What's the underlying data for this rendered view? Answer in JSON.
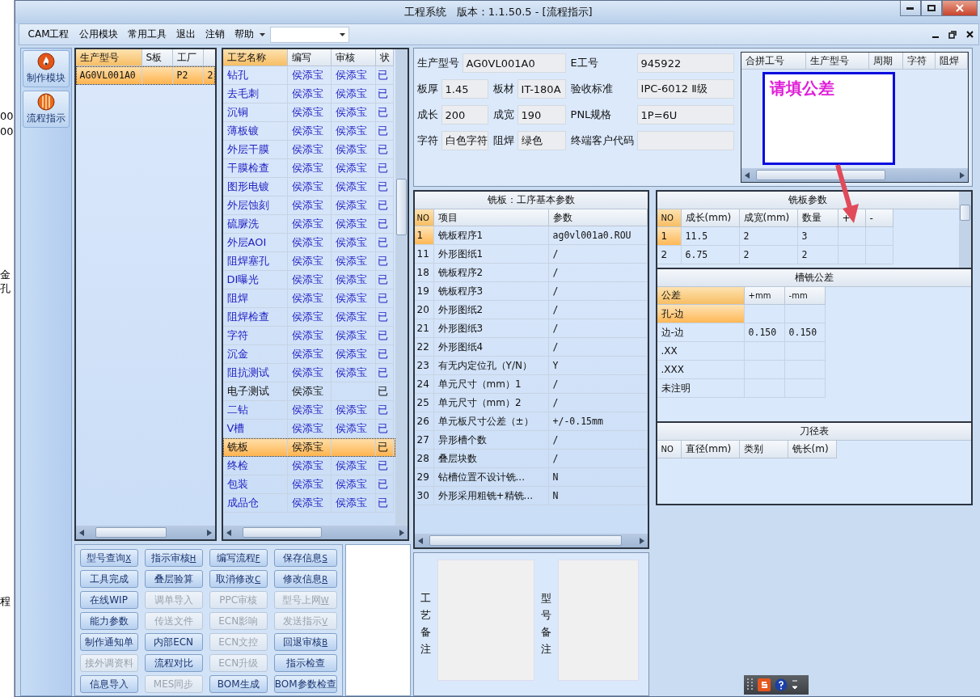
{
  "window": {
    "title": "工程系统   版本：1.1.50.5 - [流程指示]"
  },
  "background_window": {
    "texts": [
      "00",
      "00",
      "金",
      "孔",
      "程"
    ]
  },
  "menu": {
    "items": [
      "CAM工程",
      "公用模块",
      "常用工具",
      "退出",
      "注销",
      "帮助"
    ]
  },
  "nav": [
    {
      "label": "制作模块",
      "kind": "flame"
    },
    {
      "label": "流程指示",
      "kind": "stripes"
    }
  ],
  "models": {
    "columns": [
      "生产型号",
      "S板",
      "工厂"
    ],
    "rows": [
      {
        "model": "AG0VL001A0",
        "factory": "P2",
        "column_4": "2",
        "selected": true
      }
    ]
  },
  "processes": {
    "columns": [
      "工艺名称",
      "编写",
      "审核",
      "状"
    ],
    "rows": [
      {
        "name": "钻孔",
        "writer": "侯添宝",
        "reviewer": "侯添宝",
        "status": "已",
        "reviewed": true,
        "selected": false
      },
      {
        "name": "去毛刺",
        "writer": "侯添宝",
        "reviewer": "侯添宝",
        "status": "已",
        "reviewed": true,
        "selected": false
      },
      {
        "name": "沉铜",
        "writer": "侯添宝",
        "reviewer": "侯添宝",
        "status": "已",
        "reviewed": true,
        "selected": false
      },
      {
        "name": "薄板镀",
        "writer": "侯添宝",
        "reviewer": "侯添宝",
        "status": "已",
        "reviewed": true,
        "selected": false
      },
      {
        "name": "外层干膜",
        "writer": "侯添宝",
        "reviewer": "侯添宝",
        "status": "已",
        "reviewed": true,
        "selected": false
      },
      {
        "name": "干膜检查",
        "writer": "侯添宝",
        "reviewer": "侯添宝",
        "status": "已",
        "reviewed": true,
        "selected": false
      },
      {
        "name": "图形电镀",
        "writer": "侯添宝",
        "reviewer": "侯添宝",
        "status": "已",
        "reviewed": true,
        "selected": false
      },
      {
        "name": "外层蚀刻",
        "writer": "侯添宝",
        "reviewer": "侯添宝",
        "status": "已",
        "reviewed": true,
        "selected": false
      },
      {
        "name": "硫脲洗",
        "writer": "侯添宝",
        "reviewer": "侯添宝",
        "status": "已",
        "reviewed": true,
        "selected": false
      },
      {
        "name": "外层AOI",
        "writer": "侯添宝",
        "reviewer": "侯添宝",
        "status": "已",
        "reviewed": true,
        "selected": false
      },
      {
        "name": "阻焊塞孔",
        "writer": "侯添宝",
        "reviewer": "侯添宝",
        "status": "已",
        "reviewed": true,
        "selected": false
      },
      {
        "name": "DI曝光",
        "writer": "侯添宝",
        "reviewer": "侯添宝",
        "status": "已",
        "reviewed": true,
        "selected": false
      },
      {
        "name": "阻焊",
        "writer": "侯添宝",
        "reviewer": "侯添宝",
        "status": "已",
        "reviewed": true,
        "selected": false
      },
      {
        "name": "阻焊检查",
        "writer": "侯添宝",
        "reviewer": "侯添宝",
        "status": "已",
        "reviewed": true,
        "selected": false
      },
      {
        "name": "字符",
        "writer": "侯添宝",
        "reviewer": "侯添宝",
        "status": "已",
        "reviewed": true,
        "selected": false
      },
      {
        "name": "沉金",
        "writer": "侯添宝",
        "reviewer": "侯添宝",
        "status": "已",
        "reviewed": true,
        "selected": false
      },
      {
        "name": "阻抗测试",
        "writer": "侯添宝",
        "reviewer": "侯添宝",
        "status": "已",
        "reviewed": true,
        "selected": false
      },
      {
        "name": "电子测试",
        "writer": "侯添宝",
        "status": "已",
        "reviewed": false,
        "selected": false
      },
      {
        "name": "二钻",
        "writer": "侯添宝",
        "reviewer": "侯添宝",
        "status": "已",
        "reviewed": true,
        "selected": false
      },
      {
        "name": "V槽",
        "writer": "侯添宝",
        "reviewer": "侯添宝",
        "status": "已",
        "reviewed": true,
        "selected": false
      },
      {
        "name": "铣板",
        "writer": "侯添宝",
        "status": "已",
        "reviewed": false,
        "selected": true
      },
      {
        "name": "终检",
        "writer": "侯添宝",
        "reviewer": "侯添宝",
        "status": "已",
        "reviewed": true,
        "selected": false
      },
      {
        "name": "包装",
        "writer": "侯添宝",
        "reviewer": "侯添宝",
        "status": "已",
        "reviewed": true,
        "selected": false
      },
      {
        "name": "成品仓",
        "writer": "侯添宝",
        "reviewer": "侯添宝",
        "status": "已",
        "reviewed": true,
        "selected": false
      }
    ]
  },
  "buttons": [
    {
      "label": "型号查询",
      "shortcut": "X",
      "disabled": false
    },
    {
      "label": "指示审核",
      "shortcut": "H",
      "disabled": false
    },
    {
      "label": "编写流程",
      "shortcut": "F",
      "disabled": false
    },
    {
      "label": "保存信息",
      "shortcut": "S",
      "disabled": false
    },
    {
      "label": "工具完成",
      "disabled": false
    },
    {
      "label": "叠层验算",
      "disabled": false
    },
    {
      "label": "取消修改",
      "shortcut": "C",
      "disabled": false
    },
    {
      "label": "修改信息",
      "shortcut": "R",
      "disabled": false
    },
    {
      "label": "在线WIP",
      "disabled": false
    },
    {
      "label": "调单导入",
      "disabled": true
    },
    {
      "label": "PPC审核",
      "disabled": true
    },
    {
      "label": "型号上网",
      "shortcut": "W",
      "disabled": true
    },
    {
      "label": "能力参数",
      "disabled": false
    },
    {
      "label": "传送文件",
      "disabled": true
    },
    {
      "label": "ECN影响",
      "disabled": true
    },
    {
      "label": "发送指示",
      "shortcut": "V",
      "disabled": true
    },
    {
      "label": "制作通知单",
      "disabled": false
    },
    {
      "label": "内部ECN",
      "disabled": false
    },
    {
      "label": "ECN文控",
      "disabled": true
    },
    {
      "label": "回退审核",
      "shortcut": "B",
      "disabled": false
    },
    {
      "label": "接外调资料",
      "disabled": true
    },
    {
      "label": "流程对比",
      "disabled": false
    },
    {
      "label": "ECN升级",
      "disabled": true
    },
    {
      "label": "指示检查",
      "disabled": false
    },
    {
      "label": "信息导入",
      "disabled": false
    },
    {
      "label": "MES同步",
      "disabled": true
    },
    {
      "label": "BOM生成",
      "disabled": false
    },
    {
      "label": "BOM参数检查",
      "disabled": false
    }
  ],
  "info": {
    "rows": [
      [
        {
          "label": "生产型号",
          "value": "AG0VL001A0"
        },
        "",
        {
          "label": "E工号",
          "value": "945922"
        }
      ],
      [
        {
          "label": "板厚",
          "value": "1.45"
        },
        {
          "label": "板材",
          "value": "IT-180A"
        },
        {
          "label": "验收标准",
          "value": "IPC-6012 Ⅱ级"
        }
      ],
      [
        {
          "label": "成长",
          "value": "200"
        },
        {
          "label": "成宽",
          "value": "190"
        },
        {
          "label": "PNL规格",
          "value": "1P=6U"
        }
      ],
      [
        {
          "label": "字符",
          "value": "白色字符"
        },
        {
          "label": "阻焊",
          "value": "绿色"
        },
        {
          "label": "终端客户代码"
        }
      ]
    ]
  },
  "merged_table": {
    "columns": [
      "合拼工号",
      "生产型号",
      "周期",
      "字符",
      "阻焊"
    ],
    "tooltip": "请填公差"
  },
  "process_params": {
    "title": "铣板：工序基本参数",
    "columns": [
      "NO",
      "项目",
      "参数"
    ],
    "rows": [
      {
        "no": "1",
        "item": "铣板程序1",
        "value": "ag0vl001a0.ROU",
        "selected": true
      },
      {
        "no": "11",
        "item": "外形图纸1",
        "value": "/",
        "selected": false
      },
      {
        "no": "18",
        "item": "铣板程序2",
        "value": "/",
        "selected": false
      },
      {
        "no": "19",
        "item": "铣板程序3",
        "value": "/",
        "selected": false
      },
      {
        "no": "20",
        "item": "外形图纸2",
        "value": "/",
        "selected": false
      },
      {
        "no": "21",
        "item": "外形图纸3",
        "value": "/",
        "selected": false
      },
      {
        "no": "22",
        "item": "外形图纸4",
        "value": "/",
        "selected": false
      },
      {
        "no": "23",
        "item": "有无内定位孔（Y/N）",
        "value": "Y",
        "selected": false
      },
      {
        "no": "24",
        "item": "单元尺寸（mm）1",
        "value": "/",
        "selected": false
      },
      {
        "no": "25",
        "item": "单元尺寸（mm）2",
        "value": "/",
        "selected": false
      },
      {
        "no": "26",
        "item": "单元板尺寸公差（±）",
        "value": "+/-0.15mm",
        "selected": false
      },
      {
        "no": "27",
        "item": "异形槽个数",
        "value": "/",
        "selected": false
      },
      {
        "no": "28",
        "item": "叠层块数",
        "value": "/",
        "selected": false
      },
      {
        "no": "29",
        "item": "钻槽位置不设计铣...",
        "value": "N",
        "selected": false
      },
      {
        "no": "30",
        "item": "外形采用粗铣+精铣...",
        "value": "N",
        "selected": false
      }
    ]
  },
  "milling_params": {
    "title": "铣板参数",
    "columns": [
      "NO",
      "成长(mm)",
      "成宽(mm)",
      "数量",
      "+",
      "-"
    ],
    "rows": [
      {
        "cells": [
          "1",
          "11.5",
          "2",
          "3"
        ],
        "selected": true
      },
      {
        "cells": [
          "2",
          "6.75",
          "2",
          "2"
        ],
        "selected": false
      }
    ]
  },
  "slot_tolerance": {
    "title": "槽铣公差",
    "columns": [
      "公差",
      "+mm",
      "-mm"
    ],
    "rows": [
      {
        "name": "孔-边",
        "selected": true
      },
      {
        "name": "边-边",
        "plus": "0.150",
        "minus": "0.150",
        "selected": false
      },
      {
        "name": ".XX",
        "selected": false
      },
      {
        "name": ".XXX",
        "selected": false
      },
      {
        "name": "未注明",
        "selected": false
      }
    ]
  },
  "tool_table": {
    "title": "刀径表",
    "columns": [
      "NO",
      "直径(mm)",
      "类别",
      "铣长(m)"
    ]
  },
  "remarks": [
    {
      "label": "工艺备注"
    },
    {
      "label": "型号备注"
    }
  ]
}
